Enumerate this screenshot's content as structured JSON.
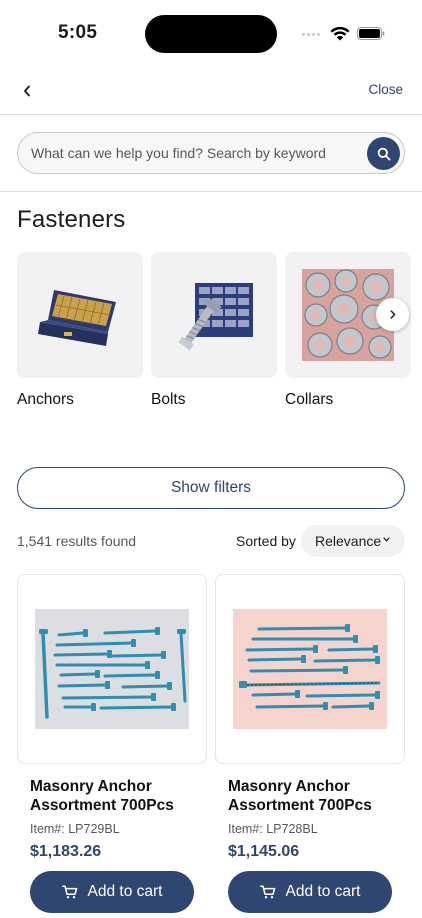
{
  "status_bar": {
    "time": "5:05"
  },
  "nav": {
    "close_label": "Close"
  },
  "search": {
    "placeholder": "What can we help you find? Search by keyword"
  },
  "category": {
    "title": "Fasteners",
    "items": [
      {
        "label": "Anchors",
        "image": "anchor-kit-image"
      },
      {
        "label": "Bolts",
        "image": "bolt-bin-image"
      },
      {
        "label": "Collars",
        "image": "shaft-collars-image"
      }
    ]
  },
  "filters": {
    "show_filters_label": "Show filters",
    "results_count": "1,541 results found",
    "sorted_by_label": "Sorted by",
    "sort_value": "Relevance"
  },
  "products": [
    {
      "name": "Masonry Anchor Assortment 700Pcs",
      "sku_label": "Item#:",
      "sku": "LP729BL",
      "price": "$1,183.26",
      "cart_label": "Add to cart",
      "image_bg": "#dcdee2"
    },
    {
      "name": "Masonry Anchor Assortment 700Pcs",
      "sku_label": "Item#:",
      "sku": "LP728BL",
      "price": "$1,145.06",
      "cart_label": "Add to cart",
      "image_bg": "#f6d3cc"
    }
  ],
  "colors": {
    "brand": "#2e4670",
    "screw_blue": "#2f8fb3"
  }
}
